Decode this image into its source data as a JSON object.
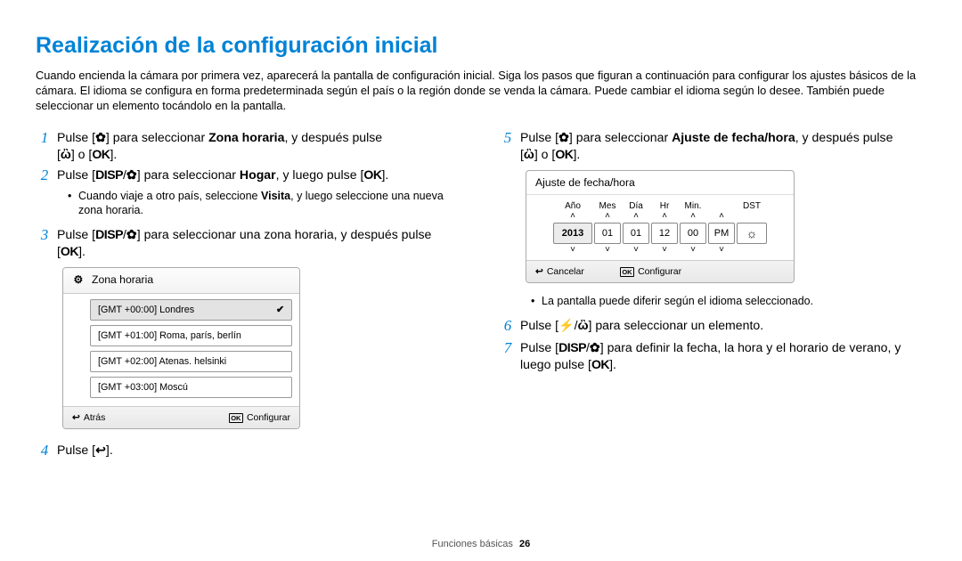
{
  "title": "Realización de la configuración inicial",
  "intro": "Cuando encienda la cámara por primera vez, aparecerá la pantalla de configuración inicial. Siga los pasos que figuran a continuación para configurar los ajustes básicos de la cámara. El idioma se configura en forma predeterminada según el país o la región donde se venda la cámara. Puede cambiar el idioma según lo desee. También puede seleccionar un elemento tocándolo en la pantalla.",
  "steps": {
    "s1_pre": "Pulse [",
    "s1_mid": "] para seleccionar ",
    "s1_bold": "Zona horaria",
    "s1_post": ", y después pulse ",
    "s1_line2_pre": "[",
    "s1_line2_mid": "] o [",
    "s1_line2_end": "].",
    "s2_pre": "Pulse [",
    "s2_mid": "] para seleccionar ",
    "s2_bold": "Hogar",
    "s2_post": ", y luego pulse [",
    "s2_end": "].",
    "s2_bullet": "Cuando viaje a otro país, seleccione ",
    "s2_bullet_bold": "Visita",
    "s2_bullet_tail": ", y luego seleccione una nueva zona horaria.",
    "s3_pre": "Pulse [",
    "s3_mid": "] para seleccionar una zona horaria, y después pulse ",
    "s3_line2_pre": "[",
    "s3_line2_end": "].",
    "s4_pre": "Pulse [",
    "s4_end": "].",
    "s5_pre": "Pulse [",
    "s5_mid": "] para seleccionar ",
    "s5_bold": "Ajuste de fecha/hora",
    "s5_post": ", y después pulse ",
    "s5_line2_pre": "[",
    "s5_line2_mid": "] o [",
    "s5_line2_end": "].",
    "s5_bullet": "La pantalla puede diferir según el idioma seleccionado.",
    "s6_pre": "Pulse [",
    "s6_mid": "] para seleccionar un elemento.",
    "s7_pre": "Pulse [",
    "s7_mid": "] para definir la fecha, la hora y el horario de verano, y ",
    "s7_line2": "luego pulse [",
    "s7_end": "]."
  },
  "tz_panel": {
    "title": "Zona horaria",
    "rows": [
      "[GMT +00:00] Londres",
      "[GMT +01:00] Roma, parís, berlín",
      "[GMT +02:00] Atenas. helsinki",
      "[GMT +03:00] Moscú"
    ],
    "back": "Atrás",
    "set": "Configurar"
  },
  "dt_panel": {
    "title": "Ajuste de fecha/hora",
    "labels": {
      "year": "Año",
      "month": "Mes",
      "day": "Día",
      "hr": "Hr",
      "min": "Min.",
      "dst": "DST"
    },
    "values": {
      "year": "2013",
      "month": "01",
      "day": "01",
      "hr": "12",
      "min": "00",
      "ampm": "PM",
      "dst": "☼"
    },
    "cancel": "Cancelar",
    "set": "Configurar"
  },
  "footer": {
    "section": "Funciones básicas",
    "page": "26"
  }
}
